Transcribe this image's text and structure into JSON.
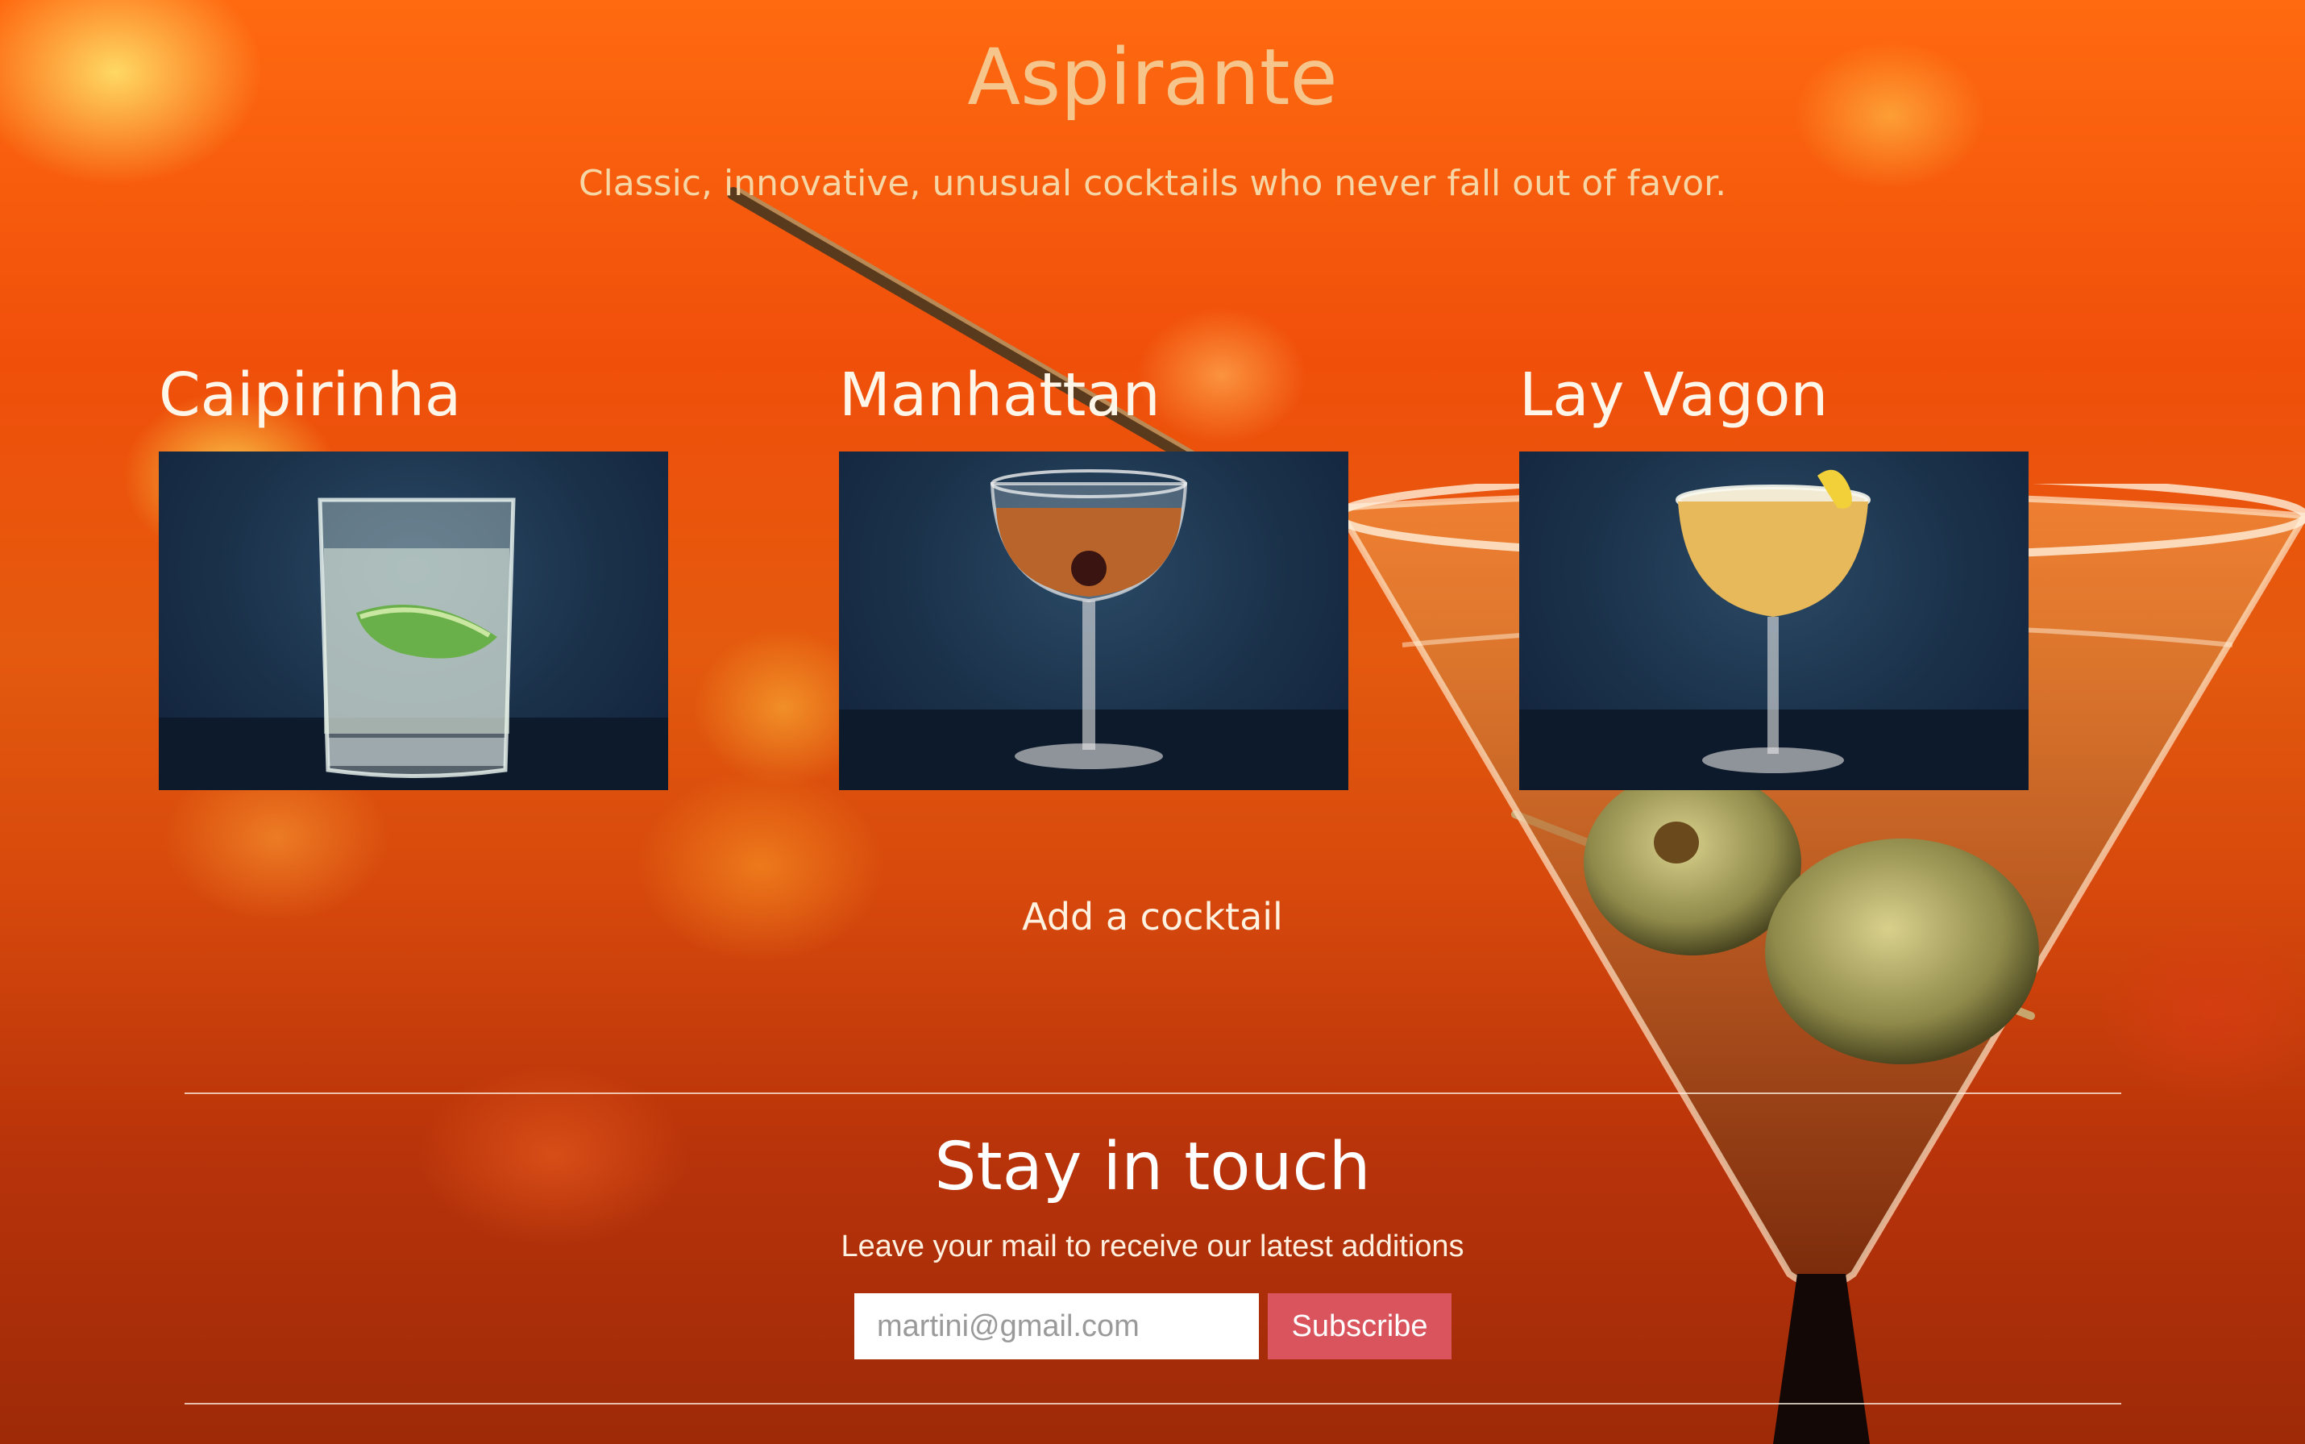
{
  "header": {
    "title": "Aspirante",
    "tagline": "Classic, innovative, unusual cocktails who never fall out of favor."
  },
  "cocktails": [
    {
      "name": "Caipirinha"
    },
    {
      "name": "Manhattan"
    },
    {
      "name": "Lay Vagon"
    }
  ],
  "add_cocktail": {
    "label": "Add a cocktail"
  },
  "newsletter": {
    "title": "Stay in touch",
    "subtitle": "Leave your mail to receive our latest additions",
    "email_placeholder": "martini@gmail.com",
    "button_label": "Subscribe"
  },
  "colors": {
    "title": "#f6c58b",
    "button": "#d9545c",
    "photo_bg": "#1a3049"
  }
}
